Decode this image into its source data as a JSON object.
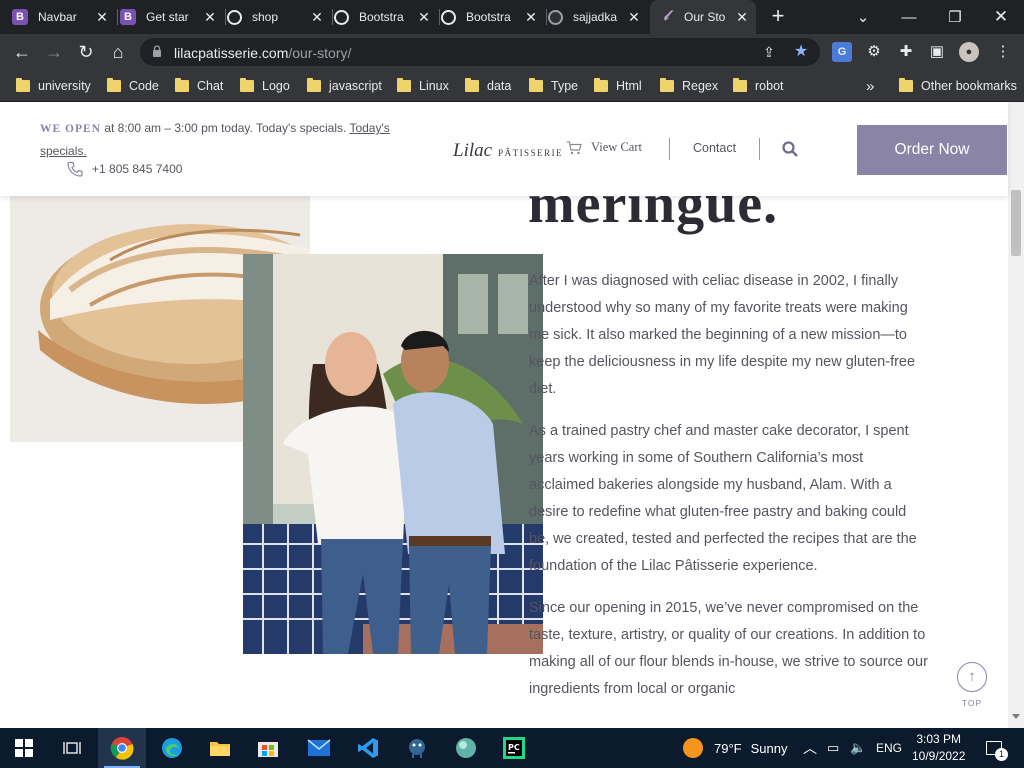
{
  "browser": {
    "tabs": [
      {
        "title": "Navbar",
        "icon": "bootstrap-icon",
        "active": false
      },
      {
        "title": "Get star",
        "icon": "bootstrap-icon",
        "active": false
      },
      {
        "title": "shop",
        "icon": "globe-icon",
        "active": false
      },
      {
        "title": "Bootstra",
        "icon": "globe-icon",
        "active": false
      },
      {
        "title": "Bootstra",
        "icon": "globe-icon",
        "active": false
      },
      {
        "title": "sajjadka",
        "icon": "github-icon",
        "active": false
      },
      {
        "title": "Our Sto",
        "icon": "lilac-icon",
        "active": true
      }
    ],
    "url_host": "lilacpatisserie.com",
    "url_path": "/our-story/",
    "bookmarks": [
      "university",
      "Code",
      "Chat",
      "Logo",
      "javascript",
      "Linux",
      "data",
      "Type",
      "Html",
      "Regex",
      "robot"
    ],
    "more_bookmarks": "»",
    "other_bookmarks": "Other bookmarks"
  },
  "site": {
    "announce_label": "WE OPEN",
    "announce_text": " at 8:00 am – 3:00 pm today. Today's specials.",
    "announce_link": "Today's specials.",
    "phone": "+1 805 845 7400",
    "logo_script": "Lilac",
    "logo_caps": "PÂTISSERIE",
    "view_cart": "View Cart",
    "contact": "Contact",
    "order_now": "Order Now",
    "brand_color": "#8a84a6"
  },
  "page": {
    "heading": "meringue.",
    "paragraphs": [
      "After I was diagnosed with celiac disease in 2002, I finally understood why so many of my favorite treats were making me sick. It also marked the beginning of a new mission—to keep the deliciousness in my life despite my new gluten-free diet.",
      "As a trained pastry chef and master cake decorator, I spent years working in some of Southern California’s most acclaimed bakeries alongside my husband, Alam. With a desire to redefine what gluten-free pastry and baking could be, we created, tested and perfected the recipes that are the foundation of the Lilac Pâtisserie experience.",
      "Since our opening in 2015, we’ve never compromised on the taste, texture, artistry, or quality of our creations. In addition to making all of our flour blends in-house, we strive to source our ingredients from local or organic"
    ],
    "top_label": "TOP"
  },
  "taskbar": {
    "weather_temp": "79°F",
    "weather_desc": "Sunny",
    "language": "ENG",
    "time": "3:03 PM",
    "date": "10/9/2022",
    "notification_count": "1"
  }
}
